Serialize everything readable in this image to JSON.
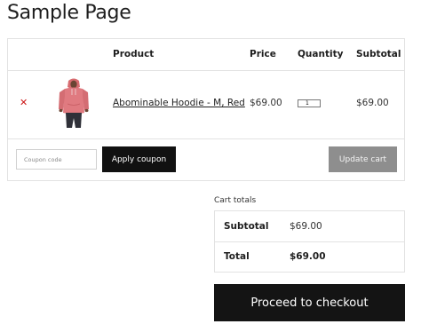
{
  "page": {
    "title": "Sample Page"
  },
  "cart": {
    "headers": {
      "product": "Product",
      "price": "Price",
      "quantity": "Quantity",
      "subtotal": "Subtotal"
    },
    "items": [
      {
        "remove_icon": "close-icon",
        "name": "Abominable Hoodie - M, Red",
        "price": "$69.00",
        "quantity": "1",
        "subtotal": "$69.00",
        "image": "pink-hoodie-thumbnail"
      }
    ],
    "coupon": {
      "placeholder": "Coupon code",
      "value": "",
      "apply_label": "Apply coupon"
    },
    "update_label": "Update cart"
  },
  "totals": {
    "heading": "Cart totals",
    "subtotal_label": "Subtotal",
    "subtotal_value": "$69.00",
    "total_label": "Total",
    "total_value": "$69.00",
    "checkout_label": "Proceed to checkout"
  },
  "colors": {
    "remove": "#cc1818",
    "button_dark": "#111111",
    "button_disabled": "#8e8e8e",
    "border": "#e2e2e2"
  }
}
